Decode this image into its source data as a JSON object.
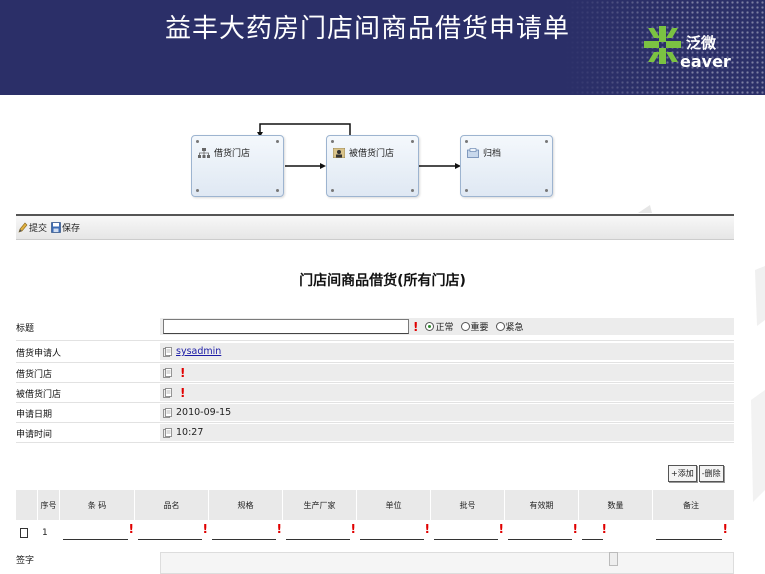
{
  "banner": {
    "title": "益丰大药房门店间商品借货申请单",
    "logo_cn": "泛微",
    "logo_en": "eaver"
  },
  "workflow": {
    "nodes": [
      {
        "label": "借货门店",
        "icon": "org-chart-icon"
      },
      {
        "label": "被借货门店",
        "icon": "person-icon"
      },
      {
        "label": "归档",
        "icon": "archive-icon"
      }
    ]
  },
  "toolbar": {
    "submit_label": "提交",
    "save_label": "保存"
  },
  "form": {
    "title": "门店间商品借货(所有门店)",
    "fields": {
      "subject": {
        "label": "标题",
        "value": ""
      },
      "priority": {
        "options": [
          "正常",
          "重要",
          "紧急"
        ],
        "selected": "正常"
      },
      "applicant": {
        "label": "借货申请人",
        "value": "sysadmin"
      },
      "borrow_store": {
        "label": "借货门店",
        "value": ""
      },
      "lend_store": {
        "label": "被借货门店",
        "value": ""
      },
      "apply_date": {
        "label": "申请日期",
        "value": "2010-09-15"
      },
      "apply_time": {
        "label": "申请时间",
        "value": "10:27"
      }
    }
  },
  "table": {
    "add_label": "+添加",
    "delete_label": "-删除",
    "columns": [
      "序号",
      "条 码",
      "品名",
      "规格",
      "生产厂家",
      "单位",
      "批号",
      "有效期",
      "数量",
      "备注"
    ],
    "rows": [
      {
        "index": "1"
      }
    ]
  },
  "sign": {
    "label": "签字"
  },
  "colors": {
    "banner": "#2b2f68",
    "required": "#e00000",
    "field_bg": "#ececec",
    "link": "#1a1aa6"
  }
}
